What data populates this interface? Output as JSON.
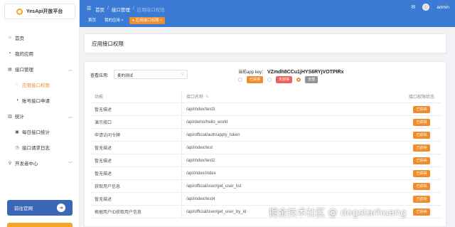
{
  "sidebar": {
    "logo_text": "YesApi开放平台",
    "items": [
      {
        "icon": "home-icon",
        "glyph": "⌂",
        "label": "首页"
      },
      {
        "icon": "app-icon",
        "glyph": "▪",
        "label": "我的应用"
      },
      {
        "icon": "api-icon",
        "glyph": "▤",
        "label": "接口管理",
        "chevron": "︿"
      },
      {
        "icon": "permission-icon",
        "glyph": "♢",
        "label": "应用接口权限",
        "active": true,
        "sub": true
      },
      {
        "icon": "apply-icon",
        "glyph": "◑",
        "label": "账号接口申请",
        "sub": true
      },
      {
        "icon": "stats-icon",
        "glyph": "▥",
        "label": "统计",
        "chevron": "︿"
      },
      {
        "icon": "calendar-icon",
        "glyph": "▣",
        "label": "每日接口统计",
        "sub": true
      },
      {
        "icon": "clock-icon",
        "glyph": "◷",
        "label": "接口请求日志",
        "sub": true
      },
      {
        "icon": "dev-icon",
        "glyph": "⚲",
        "label": "开发者中心",
        "chevron": "﹀"
      }
    ],
    "bottom_button": "前往官网"
  },
  "header": {
    "breadcrumb": [
      "首页",
      "接口管理",
      "应用接口权限"
    ],
    "tabs": [
      "首页",
      "我的应用 ×",
      "● 应用接口权限 ×"
    ],
    "user": "admin"
  },
  "page_title": "应用接口权限",
  "filter": {
    "label": "查看应用:",
    "selected": "麦的测试"
  },
  "app_key": {
    "label": "当前app key：",
    "value": "VZmdh8CCu1jHYS6RYjVOTPIRx"
  },
  "legend": {
    "obtained": "已获得",
    "not_obtained": "未获得",
    "all": "全部"
  },
  "table": {
    "headers": [
      "功能",
      "接口名称",
      "接口权限状态"
    ],
    "rows": [
      {
        "func": "暂无描述",
        "api": "/api/index/test3",
        "status": "已获得"
      },
      {
        "func": "演示接口",
        "api": "/api/demo/hello_world",
        "status": "已获得"
      },
      {
        "func": "申请访问令牌",
        "api": "/api/official/auth/apply_token",
        "status": "已获得"
      },
      {
        "func": "暂无描述",
        "api": "/api/index/test",
        "status": "已获得"
      },
      {
        "func": "暂无描述",
        "api": "/api/index/test2",
        "status": "已获得"
      },
      {
        "func": "暂无描述",
        "api": "/api/index/index",
        "status": "已获得"
      },
      {
        "func": "获取用户信息",
        "api": "/api/official/user/get_user_list",
        "status": "已获得"
      },
      {
        "func": "暂无描述",
        "api": "/api/index/test4",
        "status": "已获得"
      },
      {
        "func": "根据用户ID获取用户信息",
        "api": "/api/official/user/get_user_by_id",
        "status": "已获得"
      }
    ]
  },
  "watermark": "掘金技术社区 @ dogstarhuang",
  "colors": {
    "header": "#3b7bd6",
    "accent": "#f08c2a",
    "danger": "#f06060",
    "sidebar_button": "#3b67b9"
  }
}
